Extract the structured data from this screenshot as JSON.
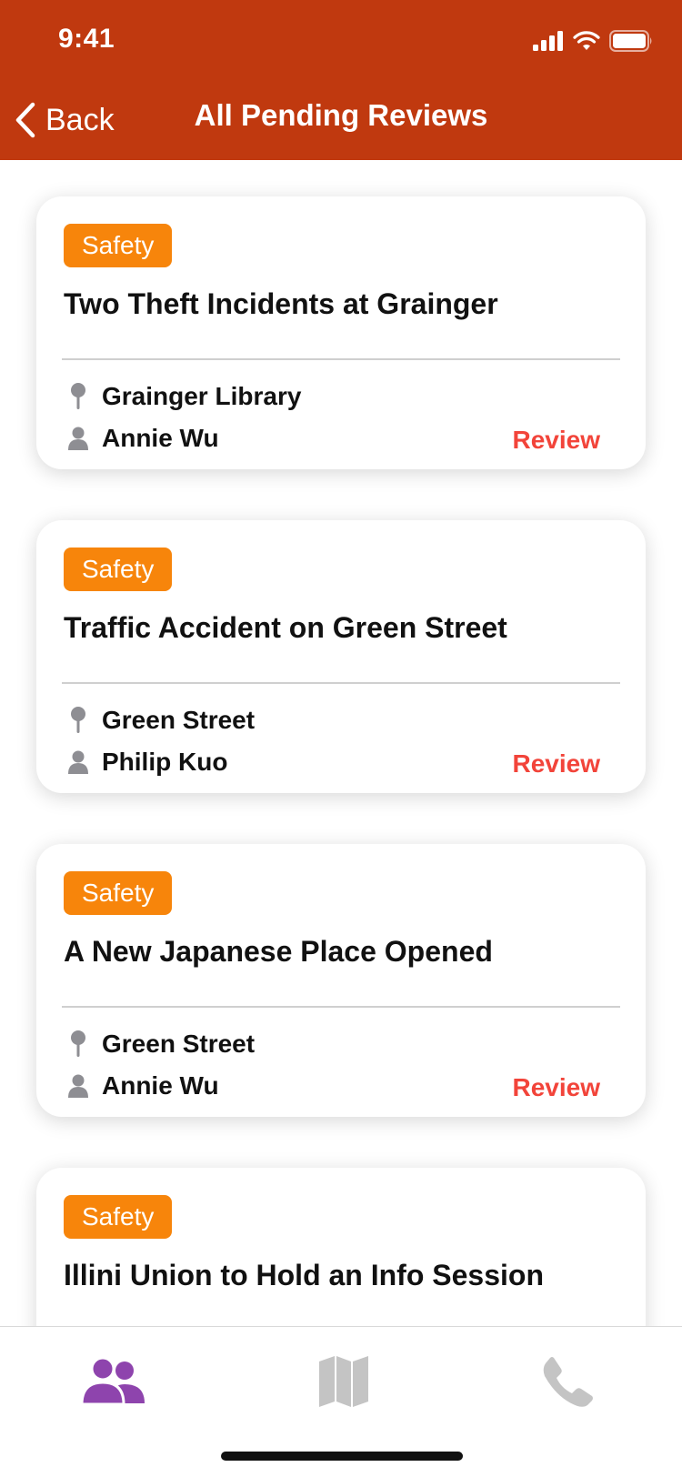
{
  "status": {
    "time": "9:41"
  },
  "nav": {
    "back_label": "Back",
    "title": "All Pending Reviews"
  },
  "cards": [
    {
      "category": "Safety",
      "title": "Two Theft Incidents at Grainger",
      "location": "Grainger Library",
      "author": "Annie Wu",
      "action": "Review"
    },
    {
      "category": "Safety",
      "title": "Traffic Accident on Green Street",
      "location": "Green Street",
      "author": "Philip Kuo",
      "action": "Review"
    },
    {
      "category": "Safety",
      "title": "A New Japanese Place Opened",
      "location": "Green Street",
      "author": "Annie Wu",
      "action": "Review"
    },
    {
      "category": "Safety",
      "title": "Illini Union to Hold an Info Session"
    }
  ],
  "tabs": [
    {
      "icon": "people-icon",
      "active": true
    },
    {
      "icon": "map-icon",
      "active": false
    },
    {
      "icon": "phone-icon",
      "active": false
    }
  ],
  "colors": {
    "header": "#c0390f",
    "badge": "#f7850b",
    "review": "#f2443a",
    "active_tab": "#8e44ad",
    "inactive_tab": "#c4c4c4"
  }
}
